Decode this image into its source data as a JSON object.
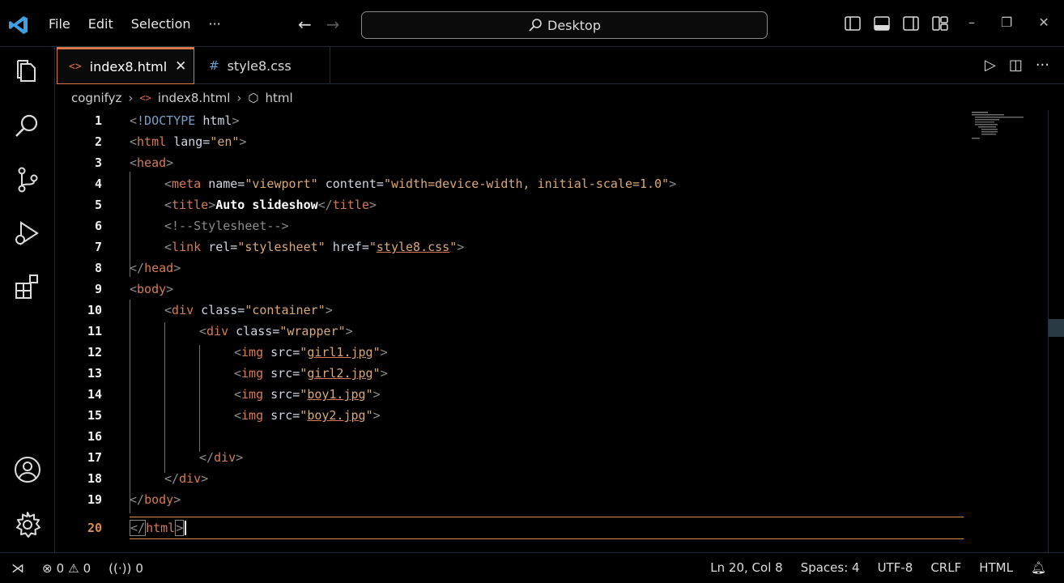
{
  "menu": {
    "file": "File",
    "edit": "Edit",
    "selection": "Selection",
    "more": "···"
  },
  "search": {
    "label": "Desktop"
  },
  "tabs": [
    {
      "label": "index8.html",
      "icon": "html-file-icon",
      "active": true
    },
    {
      "label": "style8.css",
      "icon": "css-file-icon",
      "active": false
    }
  ],
  "breadcrumb": {
    "folder": "cognifyz",
    "file": "index8.html",
    "symbol": "html"
  },
  "editor": {
    "lines": [
      {
        "n": "1"
      },
      {
        "n": "2"
      },
      {
        "n": "3"
      },
      {
        "n": "4"
      },
      {
        "n": "5"
      },
      {
        "n": "6"
      },
      {
        "n": "7"
      },
      {
        "n": "8"
      },
      {
        "n": "9"
      },
      {
        "n": "10"
      },
      {
        "n": "11"
      },
      {
        "n": "12"
      },
      {
        "n": "13"
      },
      {
        "n": "14"
      },
      {
        "n": "15"
      },
      {
        "n": "16"
      },
      {
        "n": "17"
      },
      {
        "n": "18"
      },
      {
        "n": "19"
      },
      {
        "n": "20"
      }
    ],
    "tokens": {
      "doctype_kw": "!DOCTYPE",
      "doctype_val": "html",
      "html": "html",
      "lang_attr": "lang=",
      "lang_val": "\"en\"",
      "head": "head",
      "meta": "meta",
      "name_attr": "name=",
      "name_val": "\"viewport\"",
      "content_attr": "content=",
      "content_val": "\"width=device-width, initial-scale=1.0\"",
      "title": "title",
      "title_text": "Auto slideshow",
      "comment": "<!--Stylesheet-->",
      "link": "link",
      "rel_attr": "rel=",
      "rel_val": "\"stylesheet\"",
      "href_attr": "href=",
      "q": "\"",
      "href_val": "style8.css",
      "body": "body",
      "div": "div",
      "class_attr": "class=",
      "container_val": "\"container\"",
      "wrapper_val": "\"wrapper\"",
      "img": "img",
      "src_attr": "src=",
      "src1": "girl1.jpg",
      "src2": "girl2.jpg",
      "src3": "boy1.jpg",
      "src4": "boy2.jpg"
    }
  },
  "status": {
    "errors": "0",
    "warnings": "0",
    "ports": "0",
    "position": "Ln 20, Col 8",
    "spaces": "Spaces: 4",
    "encoding": "UTF-8",
    "eol": "CRLF",
    "language": "HTML"
  },
  "colors": {
    "accent": "#d9784a",
    "tag": "#d47a58",
    "string": "#d9a878",
    "background": "#000000"
  }
}
